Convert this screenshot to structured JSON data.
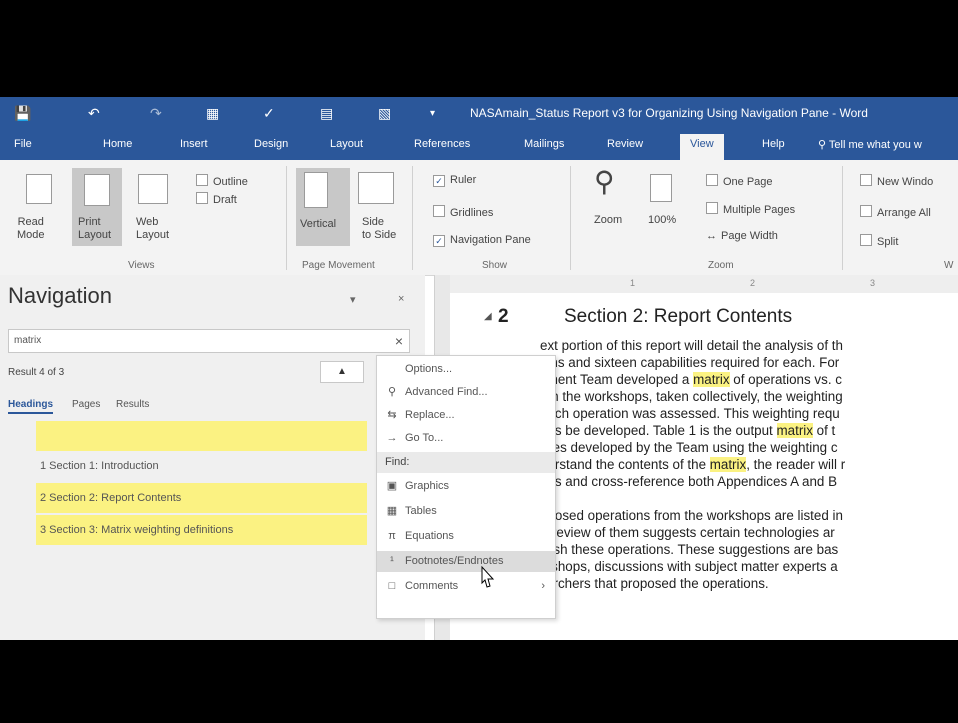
{
  "title": "NASAmain_Status Report v3 for Organizing Using Navigation Pane  -  Word",
  "ribbon_tabs": [
    "File",
    "Home",
    "Insert",
    "Design",
    "Layout",
    "References",
    "Mailings",
    "Review",
    "View",
    "Help"
  ],
  "active_tab": "View",
  "tell_me": "Tell me what you w",
  "ribbon": {
    "views": {
      "read_mode_1": "Read",
      "read_mode_2": "Mode",
      "print_1": "Print",
      "print_2": "Layout",
      "web_1": "Web",
      "web_2": "Layout",
      "outline": "Outline",
      "draft": "Draft",
      "label": "Views"
    },
    "page_movement": {
      "vertical": "Vertical",
      "side_1": "Side",
      "side_2": "to Side",
      "label": "Page Movement"
    },
    "show": {
      "ruler": "Ruler",
      "gridlines": "Gridlines",
      "navigation_pane": "Navigation Pane",
      "label": "Show"
    },
    "zoom": {
      "zoom": "Zoom",
      "percent": "100%",
      "one_page": "One Page",
      "multiple_pages": "Multiple Pages",
      "page_width": "Page Width",
      "label": "Zoom"
    },
    "window": {
      "new_window": "New Windo",
      "arrange_all": "Arrange All",
      "split": "Split",
      "label": "W"
    }
  },
  "navigation": {
    "title": "Navigation",
    "search_value": "matrix",
    "result": "Result 4 of 3",
    "tabs": [
      "Headings",
      "Pages",
      "Results"
    ],
    "headings": [
      {
        "label": "",
        "hl": true
      },
      {
        "label": "1 Section 1: Introduction",
        "hl": false
      },
      {
        "label": "2 Section 2: Report Contents",
        "hl": true
      },
      {
        "label": "3 Section 3: Matrix weighting definitions",
        "hl": true
      }
    ]
  },
  "menu": {
    "items": [
      {
        "label": "Options...",
        "icon": ""
      },
      {
        "label": "Advanced Find...",
        "icon": "search-icon"
      },
      {
        "label": "Replace...",
        "icon": "replace-icon"
      },
      {
        "label": "Go To...",
        "icon": "arrow-right-icon"
      }
    ],
    "find_header": "Find:",
    "find_items": [
      {
        "label": "Graphics",
        "icon": "graphics-icon"
      },
      {
        "label": "Tables",
        "icon": "table-icon"
      },
      {
        "label": "Equations",
        "icon": "pi-icon"
      },
      {
        "label": "Footnotes/Endnotes",
        "icon": "footnote-icon"
      },
      {
        "label": "Comments",
        "icon": "comment-icon"
      }
    ]
  },
  "ruler": {
    "ticks": [
      "1",
      "2",
      "3"
    ]
  },
  "document": {
    "section_num": "2",
    "section_title": "Section 2: Report Contents",
    "lines": [
      {
        "pre": "ext portion of this report will detail the analysis of th",
        "mark": "",
        "post": ""
      },
      {
        "pre": "ions and sixteen capabilities required for each. For",
        "mark": "",
        "post": ""
      },
      {
        "pre": "sment Team developed a ",
        "mark": "matrix",
        "post": " of operations vs. c"
      },
      {
        "pre": "om the workshops, taken collectively, the weighting",
        "mark": "",
        "post": ""
      },
      {
        "pre": "each operation was assessed. This weighting requ",
        "mark": "",
        "post": ""
      },
      {
        "pre": "ons be developed. Table 1 is the output ",
        "mark": "matrix",
        "post": " of t"
      },
      {
        "pre": "lities developed by the Team using the weighting c",
        "mark": "",
        "post": ""
      },
      {
        "pre": "derstand the contents of the ",
        "mark": "matrix",
        "post": ", the reader will r"
      },
      {
        "pre": "ons and cross-reference both Appendices A and B",
        "mark": "",
        "post": ""
      }
    ],
    "lines2": [
      "oposed operations from the workshops are listed in",
      " A review of them suggests certain technologies ar",
      "plish these operations. These suggestions are bas",
      "rkshops, discussions with subject matter experts a",
      "researchers that proposed the operations."
    ]
  },
  "colors": {
    "accent": "#2b579a",
    "highlight": "#fbf282"
  }
}
